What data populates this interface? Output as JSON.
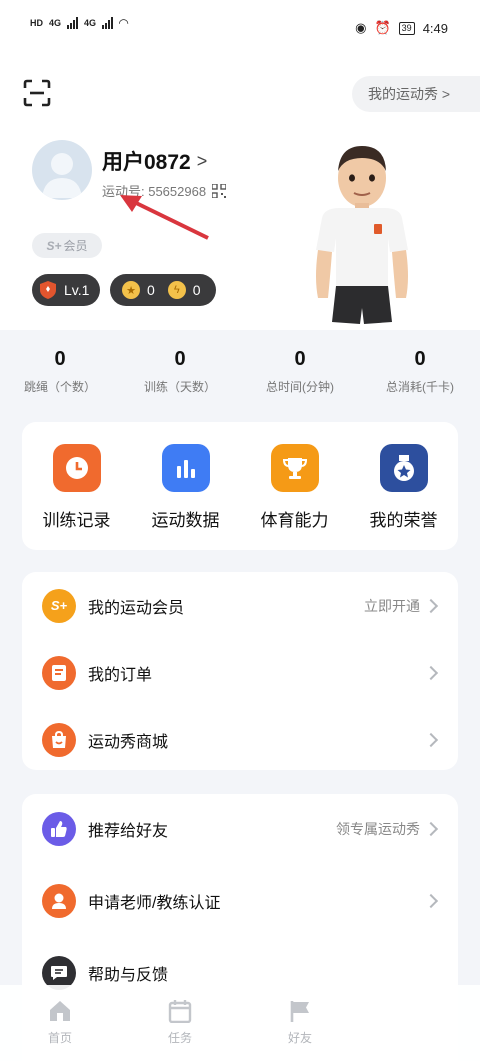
{
  "status_bar": {
    "left_tags": [
      "HD",
      "HD"
    ],
    "net_labels": [
      "4G",
      "4G"
    ],
    "battery": "39",
    "time": "4:49"
  },
  "header": {
    "show_button": "我的运动秀 >"
  },
  "profile": {
    "username": "用户0872",
    "username_chevron": ">",
    "id_label": "运动号: 55652968",
    "member_label": "会员",
    "member_logo": "S+",
    "level": "Lv.1",
    "star_coins": "0",
    "bolt_coins": "0"
  },
  "stats": [
    {
      "value": "0",
      "label": "跳绳（个数）"
    },
    {
      "value": "0",
      "label": "训练（天数）"
    },
    {
      "value": "0",
      "label": "总时间(分钟)"
    },
    {
      "value": "0",
      "label": "总消耗(千卡)"
    }
  ],
  "shortcuts": [
    {
      "label": "训练记录",
      "icon": "clock-icon",
      "color": "#f06a2e"
    },
    {
      "label": "运动数据",
      "icon": "bar-chart-icon",
      "color": "#3f7cf4"
    },
    {
      "label": "体育能力",
      "icon": "trophy-icon",
      "color": "#f59a16"
    },
    {
      "label": "我的荣誉",
      "icon": "medal-icon",
      "color": "#2d4f9e"
    }
  ],
  "menu_group_1": [
    {
      "label": "我的运动会员",
      "hint": "立即开通",
      "icon": "member-s-plus-icon",
      "icon_text": "S+",
      "color": "#f5a11b"
    },
    {
      "label": "我的订单",
      "hint": "",
      "icon": "order-icon",
      "color": "#f06a2e"
    },
    {
      "label": "运动秀商城",
      "hint": "",
      "icon": "shop-icon",
      "color": "#f06a2e"
    }
  ],
  "menu_group_2": [
    {
      "label": "推荐给好友",
      "hint": "领专属运动秀",
      "icon": "thumbs-up-icon",
      "color": "#6b5ce7"
    },
    {
      "label": "申请老师/教练认证",
      "hint": "",
      "icon": "teacher-icon",
      "color": "#f06a2e"
    },
    {
      "label": "帮助与反馈",
      "hint": "",
      "icon": "chat-icon",
      "color": "#2f2f33"
    }
  ],
  "bottom_nav": [
    {
      "label": "首页",
      "icon": "home-icon"
    },
    {
      "label": "任务",
      "icon": "calendar-icon"
    },
    {
      "label": "好友",
      "icon": "flag-icon"
    }
  ]
}
